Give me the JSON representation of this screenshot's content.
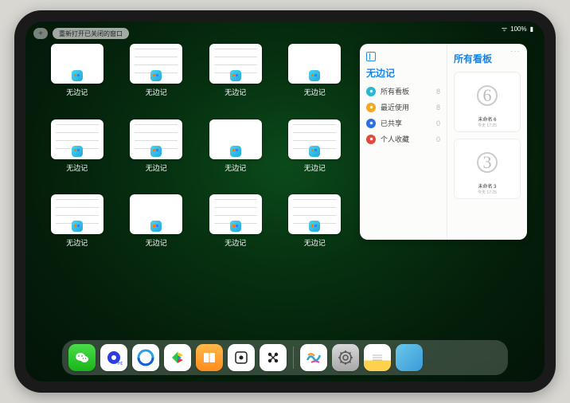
{
  "status": {
    "battery": "100%",
    "wifi": "●●●"
  },
  "top": {
    "plus": "+",
    "reopen_label": "重新打开已关闭的窗口"
  },
  "thumbs": {
    "label": "无边记",
    "items": [
      {
        "variant": "blank"
      },
      {
        "variant": "detail"
      },
      {
        "variant": "detail"
      },
      {
        "variant": "blank"
      },
      {
        "variant": "detail"
      },
      {
        "variant": "detail"
      },
      {
        "variant": "blank"
      },
      {
        "variant": "detail"
      },
      {
        "variant": "detail"
      },
      {
        "variant": "blank"
      },
      {
        "variant": "detail"
      },
      {
        "variant": "detail"
      }
    ]
  },
  "panel": {
    "title": "无边记",
    "right_title": "所有看板",
    "dots": "···",
    "items": [
      {
        "label": "所有看板",
        "count": "8",
        "color": "#29b7d3"
      },
      {
        "label": "最近使用",
        "count": "8",
        "color": "#f5a623"
      },
      {
        "label": "已共享",
        "count": "0",
        "color": "#2d6fe0"
      },
      {
        "label": "个人收藏",
        "count": "0",
        "color": "#e2493d"
      }
    ],
    "boards": [
      {
        "sketch": "6",
        "name": "未命名 6",
        "time": "今天 17:25"
      },
      {
        "sketch": "3",
        "name": "未命名 3",
        "time": "今天 17:25"
      }
    ]
  },
  "dock": {
    "icons": [
      {
        "name": "wechat-icon",
        "cls": "di-wechat"
      },
      {
        "name": "quark-icon",
        "cls": "di-quark"
      },
      {
        "name": "browser-icon",
        "cls": "di-browser"
      },
      {
        "name": "play-icon",
        "cls": "di-play"
      },
      {
        "name": "books-icon",
        "cls": "di-books"
      },
      {
        "name": "dice-icon",
        "cls": "di-dice"
      },
      {
        "name": "connect-icon",
        "cls": "di-dots"
      }
    ],
    "recent": [
      {
        "name": "freeform-icon",
        "cls": "di-freeform"
      },
      {
        "name": "settings-icon",
        "cls": "di-settings"
      },
      {
        "name": "notes-icon",
        "cls": "di-notes"
      },
      {
        "name": "app-library-icon",
        "cls": "di-folder"
      }
    ]
  }
}
